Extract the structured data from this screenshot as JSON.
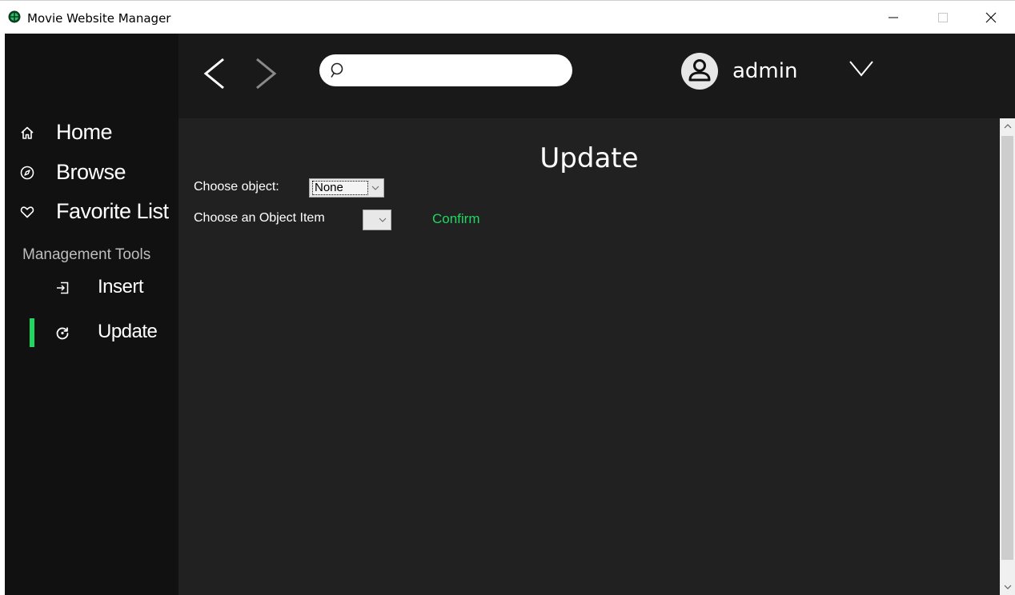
{
  "window": {
    "title": "Movie Website Manager"
  },
  "topbar": {
    "search": {
      "value": "",
      "placeholder": ""
    },
    "user": {
      "name": "admin"
    }
  },
  "sidebar": {
    "items": [
      {
        "label": "Home",
        "icon": "home-icon"
      },
      {
        "label": "Browse",
        "icon": "compass-icon"
      },
      {
        "label": "Favorite List",
        "icon": "heart-icon"
      }
    ],
    "section_label": "Management Tools",
    "tools": [
      {
        "label": "Insert",
        "icon": "insert-icon"
      },
      {
        "label": "Update",
        "icon": "refresh-icon",
        "active": true
      }
    ]
  },
  "main": {
    "title": "Update",
    "choose_object_label": "Choose object:",
    "choose_object_value": "None",
    "choose_item_label": "Choose an Object Item",
    "choose_item_value": "",
    "confirm_label": "Confirm"
  },
  "colors": {
    "accent": "#1ed760",
    "sidebar_bg": "#111111",
    "topbar_bg": "#191919",
    "content_bg": "#212121"
  }
}
